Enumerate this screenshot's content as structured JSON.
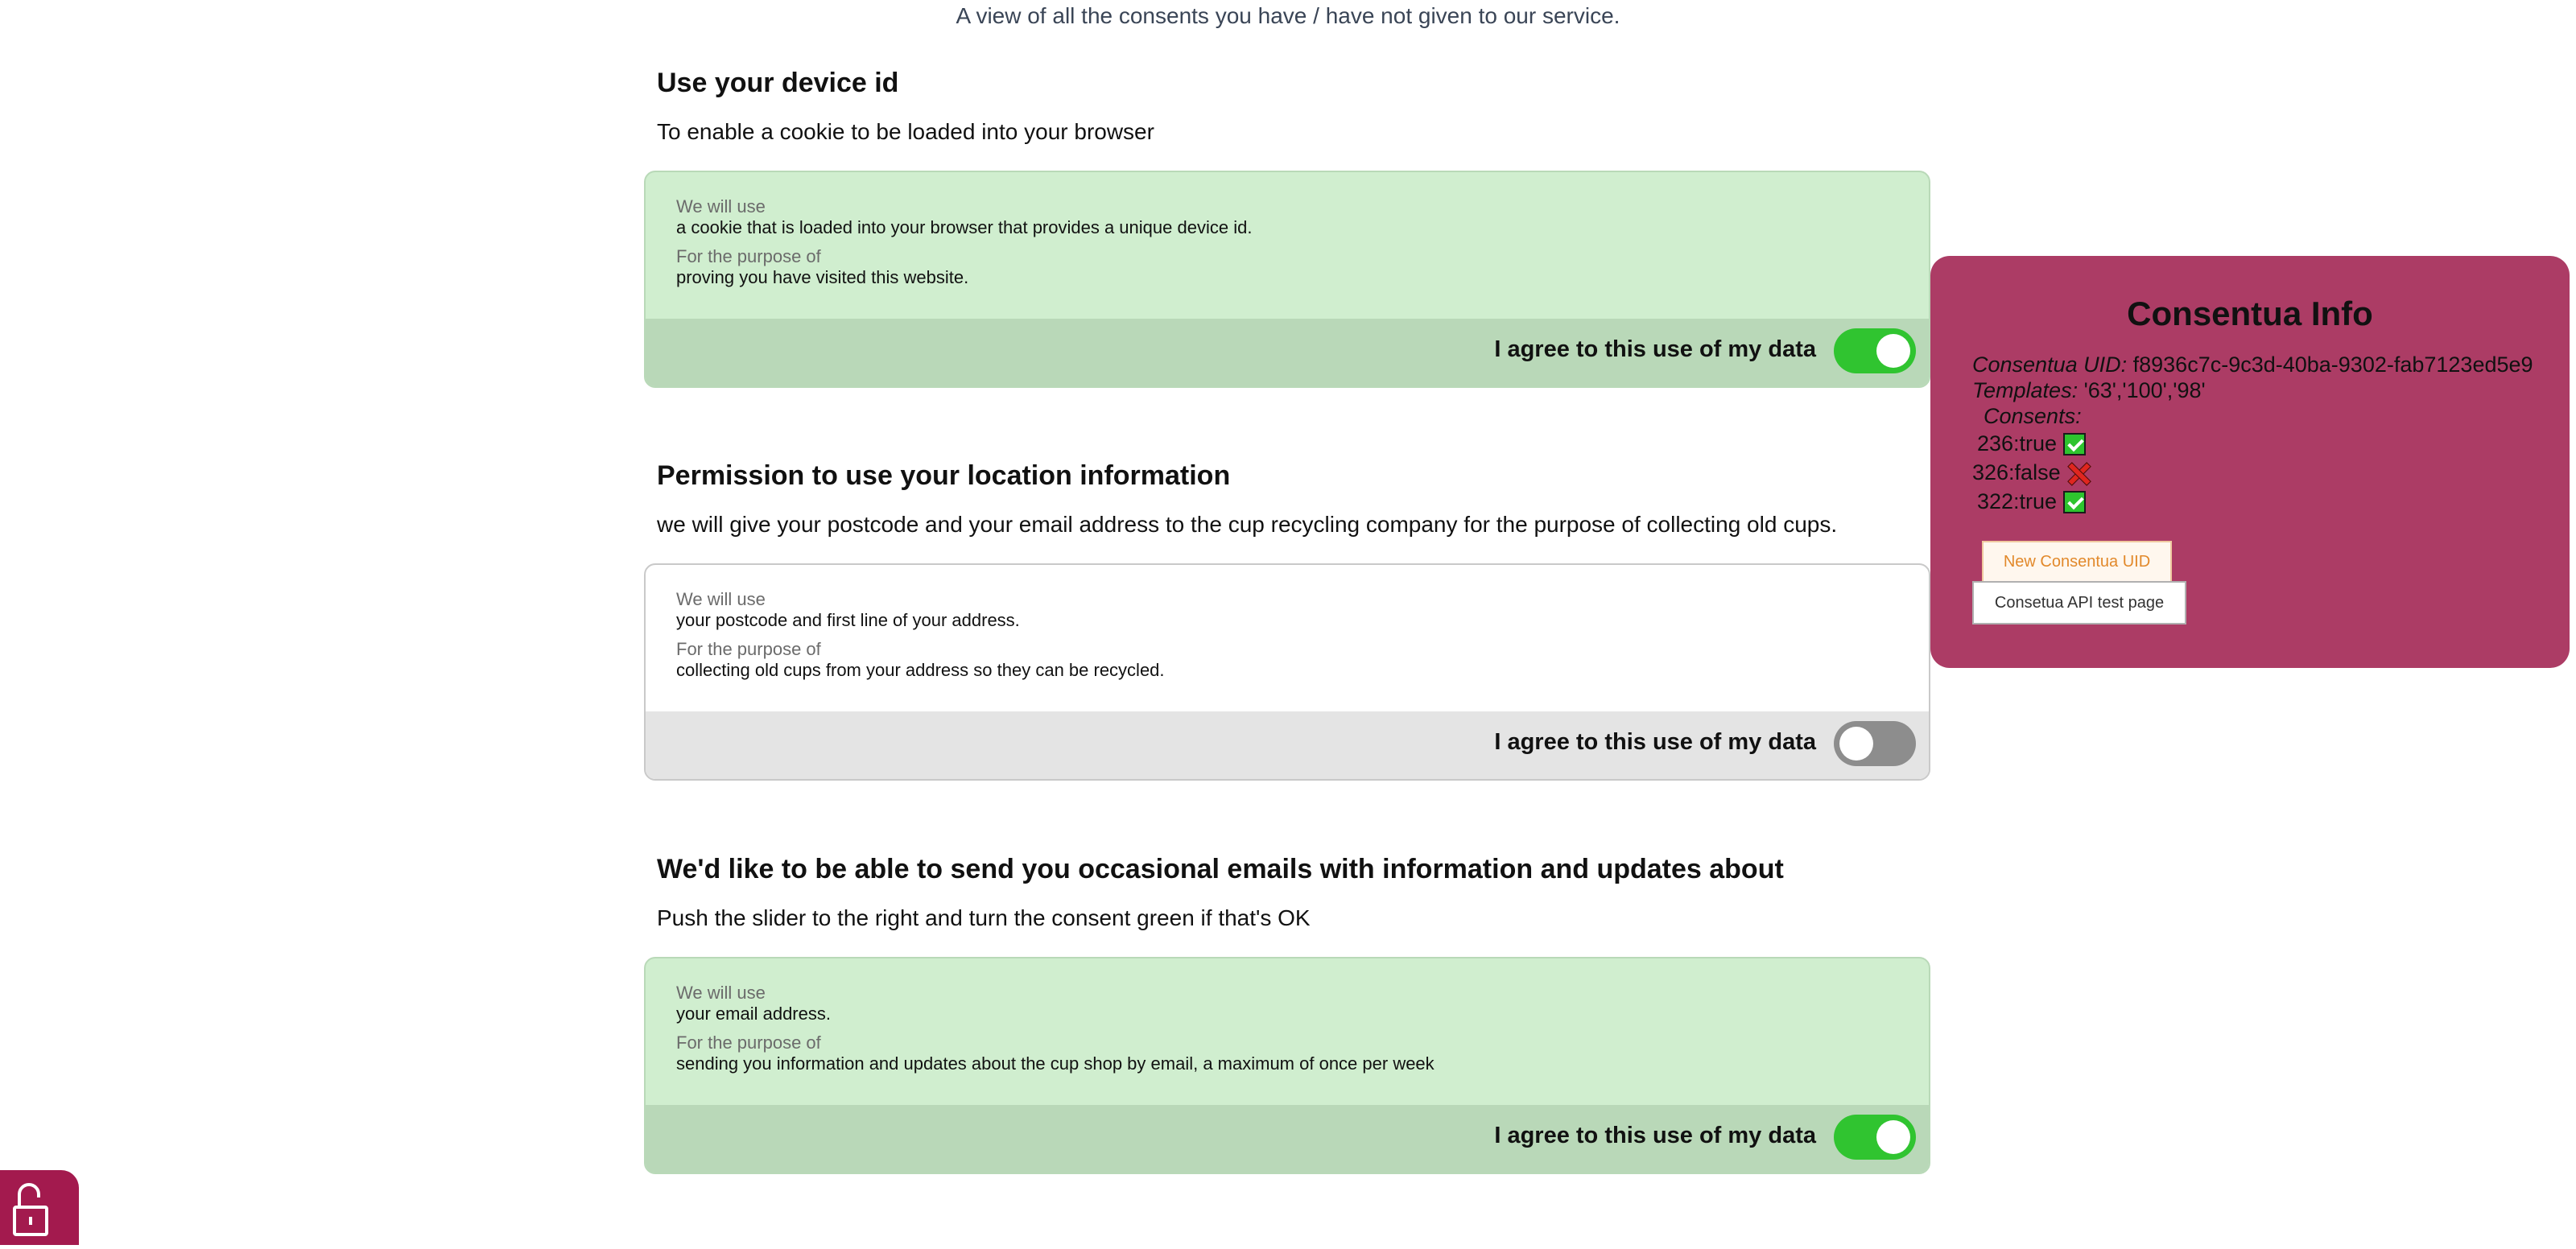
{
  "page": {
    "subtitle": "A view of all the consents you have / have not given to our service."
  },
  "consents": [
    {
      "title": "Use your device id",
      "description": "To enable a cookie to be loaded into your browser",
      "we_will_use_label": "We will use",
      "we_will_use": "a cookie that is loaded into your browser that provides a unique device id.",
      "purpose_label": "For the purpose of",
      "purpose": "proving you have visited this website.",
      "agree_label": "I agree to this use of my data",
      "agreed": true
    },
    {
      "title": "Permission to use your location information",
      "description": "we will give your postcode and your email address to the cup recycling company for the purpose of collecting old cups.",
      "we_will_use_label": "We will use",
      "we_will_use": "your postcode and first line of your address.",
      "purpose_label": "For the purpose of",
      "purpose": "collecting old cups from your address so they can be recycled.",
      "agree_label": "I agree to this use of my data",
      "agreed": false
    },
    {
      "title": "We'd like to be able to send you occasional emails with information and updates about",
      "description": "Push the slider to the right and turn the consent green if that's OK",
      "we_will_use_label": "We will use",
      "we_will_use": "your email address.",
      "purpose_label": "For the purpose of",
      "purpose": "sending you information and updates about the cup shop by email, a maximum of once per week",
      "agree_label": "I agree to this use of my data",
      "agreed": true
    }
  ],
  "info_panel": {
    "title": "Consentua Info",
    "uid_label": "Consentua UID:",
    "uid_value": "f8936c7c-9c3d-40ba-9302-fab7123ed5e9",
    "templates_label": "Templates:",
    "templates_value": "'63','100','98'",
    "consents_label": "Consents:",
    "consent_items": [
      {
        "text": "236:true",
        "status": "check-icon"
      },
      {
        "text": "326:false",
        "status": "cross-icon"
      },
      {
        "text": "322:true",
        "status": "check-icon"
      }
    ],
    "new_uid_button": "New Consentua UID",
    "api_test_button": "Consetua API test page"
  },
  "colors": {
    "consent_on_bg": "#d0eecf",
    "consent_on_footer": "#b9d8b8",
    "consent_off_footer": "#e4e4e4",
    "toggle_on": "#30c430",
    "toggle_off": "#8d8d8d",
    "info_panel_bg": "#ac3c65",
    "lock_tab_bg": "#a31a4e"
  },
  "icons": {
    "lock_tab": "unlocked-padlock-icon"
  }
}
